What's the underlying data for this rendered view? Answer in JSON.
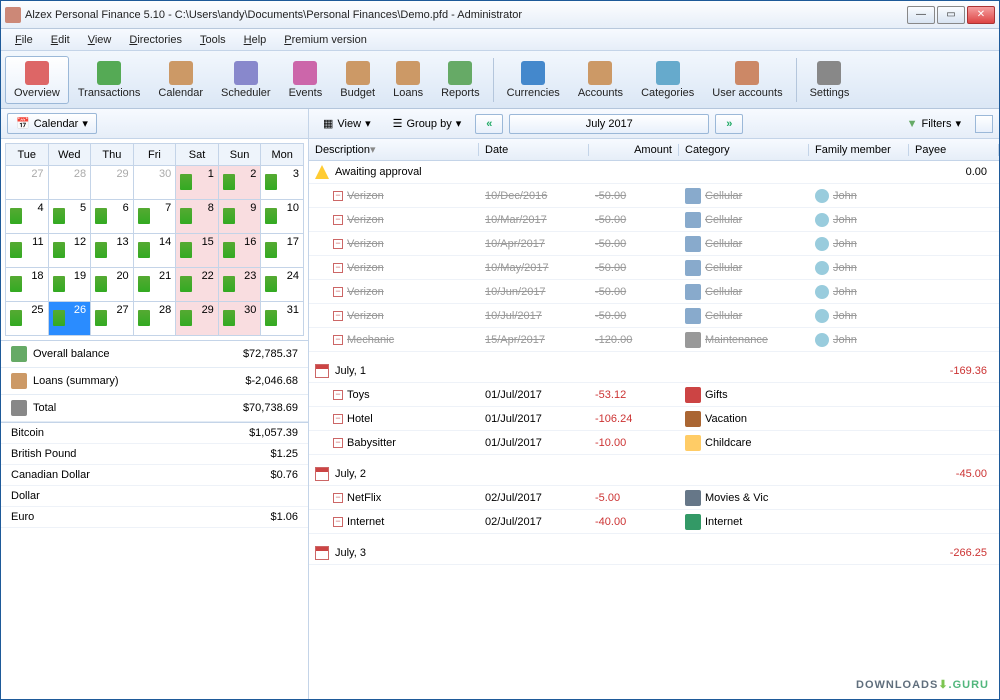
{
  "title": "Alzex Personal Finance 5.10 - C:\\Users\\andy\\Documents\\Personal Finances\\Demo.pfd - Administrator",
  "menu": [
    "File",
    "Edit",
    "View",
    "Directories",
    "Tools",
    "Help",
    "Premium version"
  ],
  "toolbar": [
    {
      "label": "Overview",
      "active": true
    },
    {
      "label": "Transactions"
    },
    {
      "label": "Calendar"
    },
    {
      "label": "Scheduler"
    },
    {
      "label": "Events"
    },
    {
      "label": "Budget"
    },
    {
      "label": "Loans"
    },
    {
      "label": "Reports"
    },
    {
      "label": "Currencies"
    },
    {
      "label": "Accounts"
    },
    {
      "label": "Categories"
    },
    {
      "label": "User accounts"
    },
    {
      "label": "Settings"
    }
  ],
  "left": {
    "dropdown": "Calendar",
    "days": [
      "Tue",
      "Wed",
      "Thu",
      "Fri",
      "Sat",
      "Sun",
      "Mon"
    ],
    "cells": [
      [
        {
          "n": "27",
          "dim": true
        },
        {
          "n": "28",
          "dim": true
        },
        {
          "n": "29",
          "dim": true
        },
        {
          "n": "30",
          "dim": true
        },
        {
          "n": "1",
          "we": true,
          "m": true
        },
        {
          "n": "2",
          "we": true,
          "m": true
        },
        {
          "n": "3",
          "m": true
        }
      ],
      [
        {
          "n": "4",
          "m": true
        },
        {
          "n": "5",
          "m": true
        },
        {
          "n": "6",
          "m": true
        },
        {
          "n": "7",
          "m": true
        },
        {
          "n": "8",
          "we": true,
          "m": true
        },
        {
          "n": "9",
          "we": true,
          "m": true
        },
        {
          "n": "10",
          "m": true
        }
      ],
      [
        {
          "n": "11",
          "m": true
        },
        {
          "n": "12",
          "m": true
        },
        {
          "n": "13",
          "m": true
        },
        {
          "n": "14",
          "m": true
        },
        {
          "n": "15",
          "we": true,
          "m": true
        },
        {
          "n": "16",
          "we": true,
          "m": true
        },
        {
          "n": "17",
          "m": true
        }
      ],
      [
        {
          "n": "18",
          "m": true
        },
        {
          "n": "19",
          "m": true
        },
        {
          "n": "20",
          "m": true
        },
        {
          "n": "21",
          "m": true
        },
        {
          "n": "22",
          "we": true,
          "m": true
        },
        {
          "n": "23",
          "we": true,
          "m": true
        },
        {
          "n": "24",
          "m": true
        }
      ],
      [
        {
          "n": "25",
          "m": true
        },
        {
          "n": "26",
          "today": true,
          "m": true
        },
        {
          "n": "27",
          "m": true
        },
        {
          "n": "28",
          "m": true
        },
        {
          "n": "29",
          "we": true,
          "m": true
        },
        {
          "n": "30",
          "we": true,
          "m": true
        },
        {
          "n": "31",
          "m": true
        }
      ]
    ],
    "summary": [
      {
        "label": "Overall balance",
        "value": "$72,785.37",
        "c": "#6a6"
      },
      {
        "label": "Loans (summary)",
        "value": "$-2,046.68",
        "c": "#c96"
      },
      {
        "label": "Total",
        "value": "$70,738.69",
        "c": "#888"
      }
    ],
    "currencies": [
      {
        "name": "Bitcoin",
        "value": "$1,057.39"
      },
      {
        "name": "British Pound",
        "value": "$1.25"
      },
      {
        "name": "Canadian Dollar",
        "value": "$0.76"
      },
      {
        "name": "Dollar",
        "value": ""
      },
      {
        "name": "Euro",
        "value": "$1.06"
      }
    ]
  },
  "right": {
    "view": "View",
    "groupby": "Group by",
    "period": "July 2017",
    "filters": "Filters",
    "cols": {
      "desc": "Description",
      "date": "Date",
      "amount": "Amount",
      "category": "Category",
      "family": "Family member",
      "payee": "Payee"
    },
    "groups": [
      {
        "title": "Awaiting approval",
        "icon": "warn",
        "amount": "0.00",
        "rows": [
          {
            "desc": "Verizon",
            "date": "10/Dec/2016",
            "amount": "-50.00",
            "cat": "Cellular",
            "fam": "John",
            "struck": true,
            "catc": "#8ac"
          },
          {
            "desc": "Verizon",
            "date": "10/Mar/2017",
            "amount": "-50.00",
            "cat": "Cellular",
            "fam": "John",
            "struck": true,
            "catc": "#8ac"
          },
          {
            "desc": "Verizon",
            "date": "10/Apr/2017",
            "amount": "-50.00",
            "cat": "Cellular",
            "fam": "John",
            "struck": true,
            "catc": "#8ac"
          },
          {
            "desc": "Verizon",
            "date": "10/May/2017",
            "amount": "-50.00",
            "cat": "Cellular",
            "fam": "John",
            "struck": true,
            "catc": "#8ac"
          },
          {
            "desc": "Verizon",
            "date": "10/Jun/2017",
            "amount": "-50.00",
            "cat": "Cellular",
            "fam": "John",
            "struck": true,
            "catc": "#8ac"
          },
          {
            "desc": "Verizon",
            "date": "10/Jul/2017",
            "amount": "-50.00",
            "cat": "Cellular",
            "fam": "John",
            "struck": true,
            "catc": "#8ac"
          },
          {
            "desc": "Mechanic",
            "date": "15/Apr/2017",
            "amount": "-120.00",
            "cat": "Maintenance",
            "fam": "John",
            "struck": true,
            "catc": "#999"
          }
        ]
      },
      {
        "title": "July, 1",
        "icon": "cal",
        "amount": "-169.36",
        "red": true,
        "rows": [
          {
            "desc": "Toys",
            "date": "01/Jul/2017",
            "amount": "-53.12",
            "cat": "Gifts",
            "catc": "#c44",
            "red": true
          },
          {
            "desc": "Hotel",
            "date": "01/Jul/2017",
            "amount": "-106.24",
            "cat": "Vacation",
            "catc": "#a63",
            "red": true
          },
          {
            "desc": "Babysitter",
            "date": "01/Jul/2017",
            "amount": "-10.00",
            "cat": "Childcare",
            "catc": "#fc6",
            "red": true
          }
        ]
      },
      {
        "title": "July, 2",
        "icon": "cal",
        "amount": "-45.00",
        "red": true,
        "rows": [
          {
            "desc": "NetFlix",
            "date": "02/Jul/2017",
            "amount": "-5.00",
            "cat": "Movies & Vic",
            "catc": "#678",
            "red": true
          },
          {
            "desc": "Internet",
            "date": "02/Jul/2017",
            "amount": "-40.00",
            "cat": "Internet",
            "catc": "#396",
            "red": true
          }
        ]
      },
      {
        "title": "July, 3",
        "icon": "cal",
        "amount": "-266.25",
        "red": true,
        "rows": []
      }
    ]
  },
  "watermark": {
    "a": "DOWNLOADS",
    "b": ".GURU"
  }
}
